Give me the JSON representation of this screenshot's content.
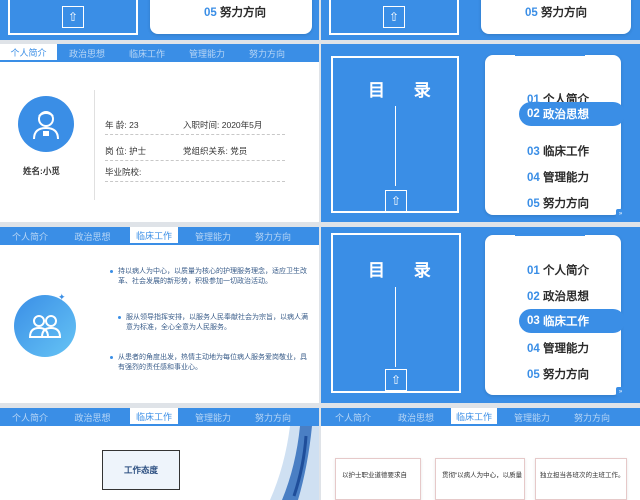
{
  "colors": {
    "primary": "#3a8ee6",
    "white": "#ffffff",
    "gray_bg": "#dfe3e8"
  },
  "toc": {
    "title": "目 录",
    "items": [
      {
        "num": "01",
        "label": "个人简介"
      },
      {
        "num": "02",
        "label": "政治思想"
      },
      {
        "num": "03",
        "label": "临床工作"
      },
      {
        "num": "04",
        "label": "管理能力"
      },
      {
        "num": "05",
        "label": "努力方向"
      }
    ],
    "quote_mark": "“",
    "scroll_icon": "double-chevron-icon"
  },
  "tabs": [
    "个人简介",
    "政治思想",
    "临床工作",
    "管理能力",
    "努力方向"
  ],
  "profile": {
    "name_label": "姓名:",
    "name_value": "小觅",
    "age_label": "年  龄:",
    "age_value": "23",
    "join_label": "入职时间:",
    "join_value": "2020年5月",
    "post_label": "岗  位:",
    "post_value": "护士",
    "party_label": "党组织关系:",
    "party_value": "党员",
    "school_label": "毕业院校:",
    "school_value": "",
    "avatar_icon": "nurse-avatar-icon"
  },
  "clinical": {
    "bullets": [
      "持以病人为中心，以质量为核心的护理服务理念，适应卫生改革、社会发展的新形势，积极参加一切政治活动。",
      "服从领导指挥安排，以服务人民奉献社会为宗旨，以病人满意为标准，全心全意为人民服务。",
      "从患者的角度出发，热情主动地为每位病人服务爱岗敬业，具有强烈的责任感和事业心。"
    ],
    "icon": "people-group-icon"
  },
  "work": {
    "attitude_label": "工作态度",
    "cards": [
      "以护士职业道德要求自",
      "贯彻“以病人为中心，以质量",
      "独立担当各班次的主班工作。"
    ]
  },
  "nav": {
    "upload_icon": "upload-arrow-icon",
    "row_label_05": "05",
    "row_label_05_text": "努力方向"
  }
}
